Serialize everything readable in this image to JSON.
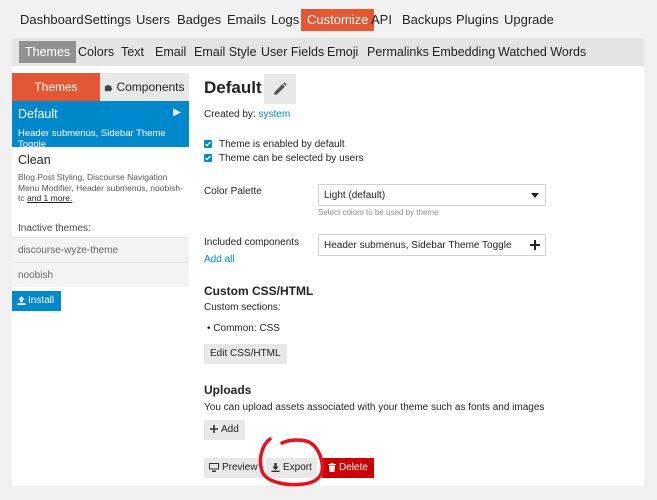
{
  "top_nav": [
    {
      "label": "Dashboard",
      "active": false
    },
    {
      "label": "Settings",
      "active": false
    },
    {
      "label": "Users",
      "active": false
    },
    {
      "label": "Badges",
      "active": false
    },
    {
      "label": "Emails",
      "active": false
    },
    {
      "label": "Logs",
      "active": false
    },
    {
      "label": "Customize",
      "active": true
    },
    {
      "label": "API",
      "active": false
    },
    {
      "label": "Backups",
      "active": false
    },
    {
      "label": "Plugins",
      "active": false
    },
    {
      "label": "Upgrade",
      "active": false
    }
  ],
  "sub_nav": [
    {
      "label": "Themes",
      "active": true
    },
    {
      "label": "Colors",
      "active": false
    },
    {
      "label": "Text",
      "active": false
    },
    {
      "label": "Email",
      "active": false
    },
    {
      "label": "Email Style",
      "active": false
    },
    {
      "label": "User Fields",
      "active": false
    },
    {
      "label": "Emoji",
      "active": false
    },
    {
      "label": "Permalinks",
      "active": false
    },
    {
      "label": "Embedding",
      "active": false
    },
    {
      "label": "Watched Words",
      "active": false
    }
  ],
  "sidebar": {
    "tabs": {
      "themes": "Themes",
      "components": "Components"
    },
    "themes": [
      {
        "name": "Default",
        "description": "Header submenus, Sidebar Theme Toggle",
        "selected": true
      },
      {
        "name": "Clean",
        "description": "Blog Post Styling, Discourse Navigation Menu Modifier, Header submenus, noobish-tc",
        "more": "and 1 more.",
        "selected": false
      }
    ],
    "inactive_label": "Inactive themes:",
    "inactive_themes": [
      "discourse-wyze-theme",
      "noobish"
    ],
    "install_label": "Install"
  },
  "detail": {
    "title": "Default",
    "created_by_label": "Created by:",
    "created_by_value": "system",
    "checkboxes": [
      {
        "label": "Theme is enabled by default",
        "checked": true
      },
      {
        "label": "Theme can be selected by users",
        "checked": true
      }
    ],
    "color_palette_label": "Color Palette",
    "color_palette_value": "Light (default)",
    "color_palette_hint": "Select colors to be used by theme",
    "components_label": "Included components",
    "components_value": "Header submenus, Sidebar Theme Toggle",
    "add_all_label": "Add all",
    "css_title": "Custom CSS/HTML",
    "custom_sections_label": "Custom sections:",
    "custom_sections": [
      "Common: CSS"
    ],
    "edit_css_label": "Edit CSS/HTML",
    "uploads_title": "Uploads",
    "uploads_text": "You can upload assets associated with your theme such as fonts and images",
    "add_label": "Add",
    "preview_label": "Preview",
    "export_label": "Export",
    "delete_label": "Delete"
  },
  "colors": {
    "accent": "#e45735",
    "link": "#0088cc",
    "danger": "#cc0000",
    "annotation": "#e8101c"
  },
  "icons": [
    "pencil-icon",
    "puzzle-icon",
    "chevron-right-icon",
    "upload-icon",
    "caret-down-icon",
    "plus-icon",
    "desktop-icon",
    "download-icon",
    "trash-icon",
    "check-icon"
  ]
}
